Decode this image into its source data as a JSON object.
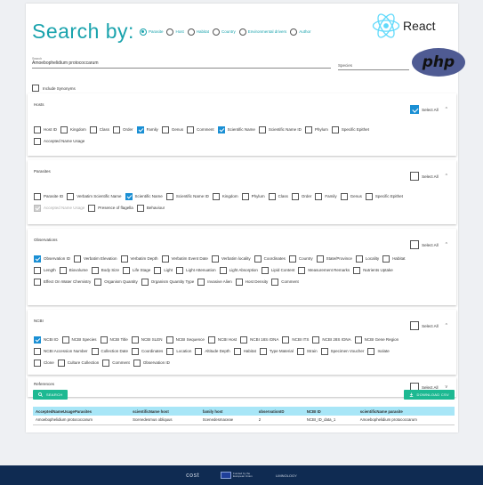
{
  "header": {
    "title": "Search by:",
    "radios": [
      {
        "label": "Parasite",
        "selected": true
      },
      {
        "label": "Host",
        "selected": false
      },
      {
        "label": "Habitat",
        "selected": false
      },
      {
        "label": "Country",
        "selected": false
      },
      {
        "label": "Environmental drivers",
        "selected": false
      },
      {
        "label": "Author",
        "selected": false
      }
    ],
    "react_text": "React",
    "php_text": "php"
  },
  "search": {
    "label": "Search",
    "value": "Amoebophelidium protococcarum",
    "species_placeholder": "Species"
  },
  "synonyms_label": "Include Synonyms",
  "sections": [
    {
      "title": "Hosts",
      "select_all_label": "Select All",
      "select_all_checked": true,
      "chevron": "^",
      "rows": [
        [
          {
            "label": "Host ID",
            "checked": false
          },
          {
            "label": "Kingdom",
            "checked": false
          },
          {
            "label": "Class",
            "checked": false
          },
          {
            "label": "Order",
            "checked": false
          },
          {
            "label": "Family",
            "checked": true
          },
          {
            "label": "Genus",
            "checked": false
          },
          {
            "label": "Comment",
            "checked": false
          },
          {
            "label": "Scientific Name",
            "checked": true
          },
          {
            "label": "Scientific Name ID",
            "checked": false
          },
          {
            "label": "Phylum",
            "checked": false
          },
          {
            "label": "Specific Epithet",
            "checked": false
          }
        ],
        [
          {
            "label": "Accepted Name Usage",
            "checked": false
          }
        ]
      ]
    },
    {
      "title": "Parasites",
      "select_all_label": "Select All",
      "select_all_checked": false,
      "chevron": "^",
      "rows": [
        [
          {
            "label": "Parasite ID",
            "checked": false
          },
          {
            "label": "Verbatim Scientific Name",
            "checked": false
          },
          {
            "label": "Scientific Name",
            "checked": true
          },
          {
            "label": "Scientific Name ID",
            "checked": false
          },
          {
            "label": "Kingdom",
            "checked": false
          },
          {
            "label": "Phylum",
            "checked": false
          },
          {
            "label": "Class",
            "checked": false
          },
          {
            "label": "Order",
            "checked": false
          },
          {
            "label": "Family",
            "checked": false
          },
          {
            "label": "Genus",
            "checked": false
          },
          {
            "label": "Specific Epithet",
            "checked": false
          }
        ],
        [
          {
            "label": "Accepted Name Usage",
            "checked": true,
            "disabled": true
          },
          {
            "label": "Presence of flagella",
            "checked": false
          },
          {
            "label": "Behaviour",
            "checked": false
          }
        ]
      ]
    },
    {
      "title": "Observations",
      "select_all_label": "Select All",
      "select_all_checked": false,
      "chevron": "^",
      "rows": [
        [
          {
            "label": "Observation ID",
            "checked": true
          },
          {
            "label": "Verbatim Elevation",
            "checked": false
          },
          {
            "label": "Verbatim Depth",
            "checked": false
          },
          {
            "label": "Verbatim Event Date",
            "checked": false
          },
          {
            "label": "Verbatim locality",
            "checked": false
          },
          {
            "label": "Coordinates",
            "checked": false
          },
          {
            "label": "Country",
            "checked": false
          },
          {
            "label": "State/Province",
            "checked": false
          },
          {
            "label": "Locality",
            "checked": false
          },
          {
            "label": "Habitat",
            "checked": false
          }
        ],
        [
          {
            "label": "Length",
            "checked": false
          },
          {
            "label": "Biovolume",
            "checked": false
          },
          {
            "label": "Body Size",
            "checked": false
          },
          {
            "label": "Life Stage",
            "checked": false
          },
          {
            "label": "Light",
            "checked": false
          },
          {
            "label": "Light Attenuation",
            "checked": false
          },
          {
            "label": "Light Absorption",
            "checked": false
          },
          {
            "label": "Lipid Content",
            "checked": false
          },
          {
            "label": "Measurement Remarks",
            "checked": false
          },
          {
            "label": "Nutrients Uptake",
            "checked": false
          }
        ],
        [
          {
            "label": "Effect On Water Chemistry",
            "checked": false
          },
          {
            "label": "Organism Quantity",
            "checked": false
          },
          {
            "label": "Organism Quantity Type",
            "checked": false
          },
          {
            "label": "Invasive Alien",
            "checked": false
          },
          {
            "label": "Host Density",
            "checked": false
          },
          {
            "label": "Comment",
            "checked": false
          }
        ]
      ]
    },
    {
      "title": "NCBI",
      "select_all_label": "Select All",
      "select_all_checked": false,
      "chevron": "^",
      "rows": [
        [
          {
            "label": "NCBI ID",
            "checked": true
          },
          {
            "label": "NCBI Species",
            "checked": false
          },
          {
            "label": "NCBI Title",
            "checked": false
          },
          {
            "label": "NCBI SLEN",
            "checked": false
          },
          {
            "label": "NCBI Sequence",
            "checked": false
          },
          {
            "label": "NCBI Host",
            "checked": false
          },
          {
            "label": "NCBI 18S rDNA",
            "checked": false
          },
          {
            "label": "NCBI ITS",
            "checked": false
          },
          {
            "label": "NCBI 28S rDNA",
            "checked": false
          },
          {
            "label": "NCBI Gene Region",
            "checked": false
          }
        ],
        [
          {
            "label": "NCBI Accession Number",
            "checked": false
          },
          {
            "label": "Collection Date",
            "checked": false
          },
          {
            "label": "Coordinates",
            "checked": false
          },
          {
            "label": "Location",
            "checked": false
          },
          {
            "label": "Altitude Depth",
            "checked": false
          },
          {
            "label": "Habitat",
            "checked": false
          },
          {
            "label": "Type Material",
            "checked": false
          },
          {
            "label": "Strain",
            "checked": false
          },
          {
            "label": "Specimen Voucher",
            "checked": false
          },
          {
            "label": "Isolate",
            "checked": false
          }
        ],
        [
          {
            "label": "Clone",
            "checked": false
          },
          {
            "label": "Culture Collection",
            "checked": false
          },
          {
            "label": "Comment",
            "checked": false
          },
          {
            "label": "Observation ID",
            "checked": false
          }
        ]
      ]
    },
    {
      "title": "References",
      "select_all_label": "Select All",
      "select_all_checked": false,
      "chevron": "v",
      "rows": []
    }
  ],
  "buttons": {
    "search_label": "SEARCH",
    "search_icon": "search-icon",
    "download_label": "DOWNLOAD CSV",
    "download_icon": "download-icon"
  },
  "table": {
    "headers": [
      "AcceptedNameUsageParasites",
      "scientificName host",
      "family host",
      "observationID",
      "NCBI ID",
      "scientificName parasite"
    ],
    "rows": [
      [
        "Amoebophelidium protococcarum",
        "Scenedesmus obliquus",
        "Scenedesmaceae",
        "2",
        "NCBI_ID_data_1",
        "Amoebophelidium protococcarum"
      ]
    ]
  },
  "footer": {
    "logos": [
      "cost",
      "Funded by the European Union",
      "LIMNOLOGY"
    ]
  },
  "colors": {
    "accent": "#1aa3ad",
    "checkbox": "#1a8fd4",
    "button": "#1db992",
    "table_header": "#a8e6f7",
    "footer": "#0f2b52"
  }
}
